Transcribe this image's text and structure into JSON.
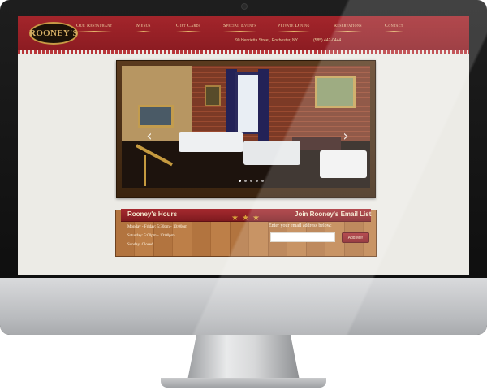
{
  "site": {
    "logo_text": "ROONEY'S",
    "nav": [
      "Our Restaurant",
      "Menus",
      "Gift Cards",
      "Special Events",
      "Private Dining",
      "Reservations",
      "Contact"
    ],
    "address": "90 Henrietta Street, Rochester, NY",
    "phone": "(585) 442-0444"
  },
  "slideshow": {
    "prev_icon": "chevron-left-icon",
    "next_icon": "chevron-right-icon",
    "prev_glyph": "‹",
    "next_glyph": "›",
    "dot_count": 5,
    "active_dot": 0
  },
  "hours": {
    "title": "Rooney's Hours",
    "lines": [
      "Monday - Friday: 5:30pm - 10:00pm",
      "Saturday: 5:00pm - 10:00pm",
      "Sunday: Closed"
    ]
  },
  "stars": [
    "★",
    "★",
    "★"
  ],
  "email": {
    "title": "Join Rooney's Email List",
    "instructions": "Enter your email address below:",
    "placeholder": "",
    "button_label": "Add Me!"
  },
  "colors": {
    "header_red": "#9a2228",
    "accent_gold": "#d7a13a",
    "wood": "#b2743f"
  }
}
